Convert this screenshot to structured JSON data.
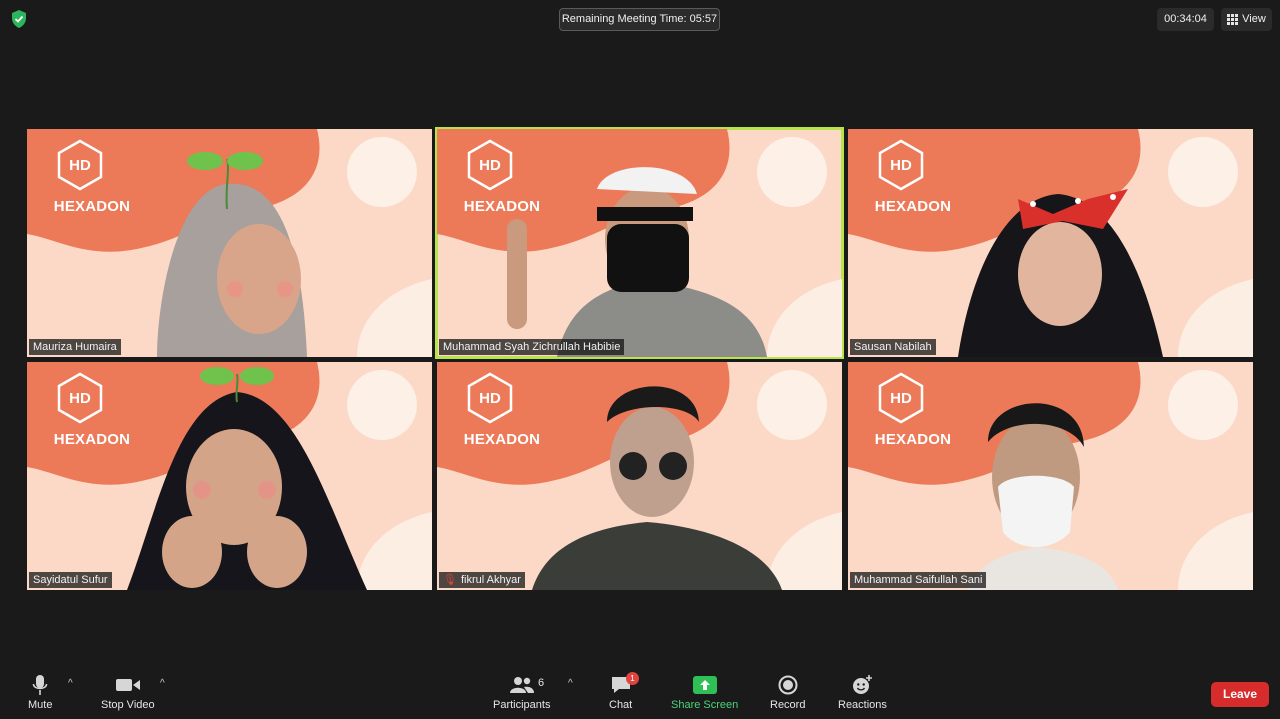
{
  "top_bar": {
    "remaining_time": "Remaining Meeting Time: 05:57",
    "elapsed_time": "00:34:04",
    "view_label": "View"
  },
  "tiles": [
    {
      "name": "Mauriza Humaira",
      "logo_initials": "HD",
      "logo_text": "HEXADON",
      "muted": false,
      "active": false
    },
    {
      "name": "Muhammad Syah Zichrullah Habibie",
      "logo_initials": "HD",
      "logo_text": "HEXADON",
      "muted": false,
      "active": true
    },
    {
      "name": "Sausan Nabilah",
      "logo_initials": "HD",
      "logo_text": "HEXADON",
      "muted": false,
      "active": false
    },
    {
      "name": "Sayidatul Sufur",
      "logo_initials": "HD",
      "logo_text": "HEXADON",
      "muted": false,
      "active": false
    },
    {
      "name": "fikrul Akhyar",
      "logo_initials": "HD",
      "logo_text": "HEXADON",
      "muted": true,
      "active": false
    },
    {
      "name": "Muhammad Saifullah Sani",
      "logo_initials": "HD",
      "logo_text": "HEXADON",
      "muted": false,
      "active": false
    }
  ],
  "toolbar": {
    "mute_label": "Mute",
    "stop_video_label": "Stop Video",
    "participants_label": "Participants",
    "participants_count": "6",
    "chat_label": "Chat",
    "chat_badge": "1",
    "share_label": "Share Screen",
    "record_label": "Record",
    "reactions_label": "Reactions",
    "leave_label": "Leave"
  },
  "colors": {
    "background": "#1a1a1a",
    "tile_bg": "#fcd9c6",
    "tile_blob": "#ec7a58",
    "active_speaker": "#b8e34a",
    "share_green": "#4cd37a",
    "leave_red": "#d72c2c"
  },
  "icons": [
    "shield-check-icon",
    "grid-view-icon",
    "microphone-icon",
    "video-camera-icon",
    "participants-icon",
    "chat-icon",
    "share-screen-icon",
    "record-icon",
    "reactions-icon",
    "mic-muted-icon"
  ]
}
